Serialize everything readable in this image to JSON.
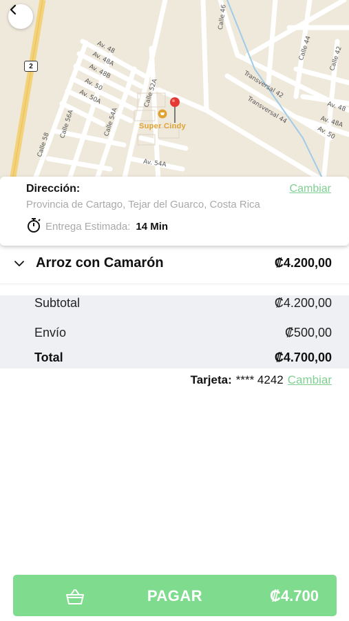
{
  "map": {
    "route_number": "2",
    "store_name": "Super Cindy",
    "street_labels": [
      "Av. 48",
      "Av. 48A",
      "Av. 48B",
      "Av. 50",
      "Av. 50A",
      "Calle 56A",
      "Calle 54A",
      "Calle 58",
      "Calle 52A",
      "Av. 54A",
      "Calle 46",
      "Calle 44",
      "Calle 42",
      "Transversal 42",
      "Transversal 44",
      "Av. 48",
      "Av. 48A",
      "Av. 50"
    ]
  },
  "address": {
    "title": "Dirección:",
    "change_label": "Cambiar",
    "text": "Provincia de Cartago, Tejar del Guarco, Costa Rica",
    "eta_label": "Entrega Estimada:",
    "eta_value": "14 Min"
  },
  "item": {
    "name": "Arroz con Camarón",
    "price": "₡4.200,00"
  },
  "summary": {
    "subtotal_label": "Subtotal",
    "subtotal_value": "₡4.200,00",
    "shipping_label": "Envío",
    "shipping_value": "₡500,00",
    "total_label": "Total",
    "total_value": "₡4.700,00"
  },
  "payment": {
    "card_label": "Tarjeta:",
    "card_number": "**** 4242",
    "change_label": "Cambiar"
  },
  "pay_button": {
    "label": "PAGAR",
    "amount": "₡4.700"
  },
  "colors": {
    "accent": "#7fdb8e",
    "link": "#7fcf92",
    "pin": "#e53935",
    "store": "#e0a230"
  }
}
